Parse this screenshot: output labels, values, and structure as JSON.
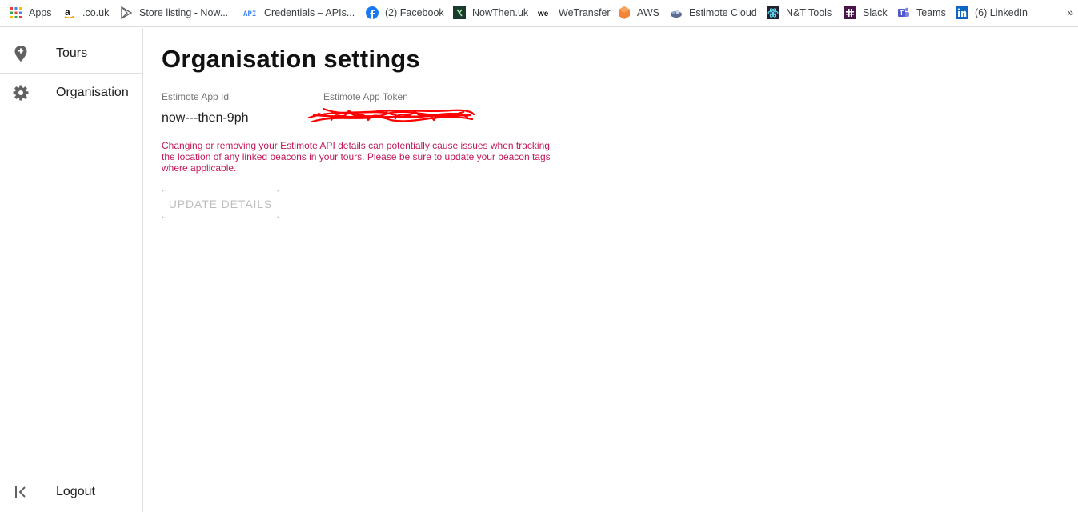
{
  "bookmarks": [
    {
      "label": "Apps",
      "icon": "apps-grid-icon"
    },
    {
      "label": ".co.uk",
      "icon": "amazon-icon"
    },
    {
      "label": "Store listing - Now...",
      "icon": "play-store-icon"
    },
    {
      "label": "Credentials – APIs...",
      "icon": "api-icon"
    },
    {
      "label": "(2) Facebook",
      "icon": "facebook-icon"
    },
    {
      "label": "NowThen.uk",
      "icon": "nowthen-icon"
    },
    {
      "label": "WeTransfer",
      "icon": "wetransfer-icon"
    },
    {
      "label": "AWS",
      "icon": "aws-icon"
    },
    {
      "label": "Estimote Cloud",
      "icon": "estimote-icon"
    },
    {
      "label": "N&T Tools",
      "icon": "react-icon"
    },
    {
      "label": "Slack",
      "icon": "slack-icon"
    },
    {
      "label": "Teams",
      "icon": "teams-icon"
    },
    {
      "label": "(6) LinkedIn",
      "icon": "linkedin-icon"
    }
  ],
  "bookmarks_more": "»",
  "sidebar": {
    "items": [
      {
        "label": "Tours",
        "icon": "location-pin-icon"
      },
      {
        "label": "Organisation",
        "icon": "gear-icon"
      }
    ],
    "logout": {
      "label": "Logout",
      "icon": "collapse-left-icon"
    }
  },
  "main": {
    "title": "Organisation settings",
    "app_id": {
      "label": "Estimote App Id",
      "value": "now---then-9ph"
    },
    "app_token": {
      "label": "Estimote App Token",
      "value": ""
    },
    "warning": "Changing or removing your Estimote API details can potentially cause issues when tracking the location of any linked beacons in your tours. Please be sure to update your beacon tags where applicable.",
    "update_button": "UPDATE DETAILS"
  },
  "colors": {
    "warning_text": "#c2185b",
    "redaction": "#ff0000",
    "disabled_button": "#bdbdbd"
  }
}
